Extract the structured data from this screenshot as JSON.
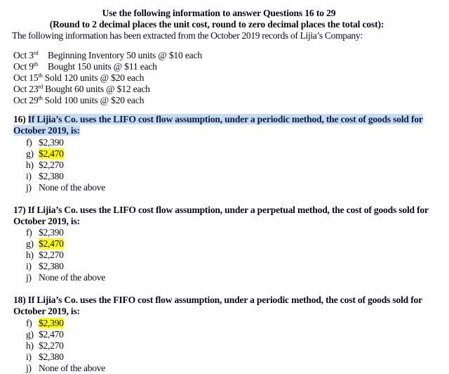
{
  "header": {
    "line1": "Use the following information to answer Questions 16 to 29",
    "line2": "(Round to 2 decimal places the unit cost, round to zero decimal places the total cost):"
  },
  "intro": "The following information has been extracted from the October 2019 records of Lijia’s Company:",
  "records": [
    {
      "date_prefix": "Oct 3",
      "suffix": "rd",
      "text": "Beginning Inventory 50 units @ $10 each"
    },
    {
      "date_prefix": "Oct 9",
      "suffix": "th",
      "text": "Bought 150 units @ $11 each"
    },
    {
      "date_prefix": "Oct 15",
      "suffix": "th",
      "text": "Sold 120 units @ $20 each"
    },
    {
      "date_prefix": "Oct 23",
      "suffix": "rd",
      "text": "Bought 60 units @ $12 each"
    },
    {
      "date_prefix": "Oct 29",
      "suffix": "th",
      "text": "Sold 100 units @ $20 each"
    }
  ],
  "questions": [
    {
      "number": "16)",
      "text": "If Lijia’s Co. uses the LIFO cost flow assumption, under a periodic method, the cost of goods sold for October 2019, is:",
      "selected": true,
      "options": [
        {
          "letter": "f)",
          "value": "$2,390",
          "highlighted": false
        },
        {
          "letter": "g)",
          "value": "$2,470",
          "highlighted": true
        },
        {
          "letter": "h)",
          "value": "$2,270",
          "highlighted": false
        },
        {
          "letter": "i)",
          "value": "$2,380",
          "highlighted": false
        },
        {
          "letter": "j)",
          "value": "None of the above",
          "highlighted": false
        }
      ]
    },
    {
      "number": "17)",
      "text": "If Lijia’s Co. uses the LIFO cost flow assumption, under a perpetual method, the cost of goods sold for October 2019, is:",
      "selected": false,
      "options": [
        {
          "letter": "f)",
          "value": "$2,390",
          "highlighted": false
        },
        {
          "letter": "g)",
          "value": "$2,470",
          "highlighted": true
        },
        {
          "letter": "h)",
          "value": "$2,270",
          "highlighted": false
        },
        {
          "letter": "i)",
          "value": "$2,380",
          "highlighted": false
        },
        {
          "letter": "j)",
          "value": "None of the above",
          "highlighted": false
        }
      ]
    },
    {
      "number": "18)",
      "text": "If Lijia’s Co. uses the FIFO cost flow assumption, under a periodic method, the cost of goods sold for October 2019, is:",
      "selected": false,
      "options": [
        {
          "letter": "f)",
          "value": "$2,390",
          "highlighted": true
        },
        {
          "letter": "g)",
          "value": "$2,470",
          "highlighted": false
        },
        {
          "letter": "h)",
          "value": "$2,270",
          "highlighted": false
        },
        {
          "letter": "i)",
          "value": "$2,380",
          "highlighted": false
        },
        {
          "letter": "j)",
          "value": "None of the above",
          "highlighted": false
        }
      ]
    }
  ],
  "colors": {
    "text": "#0b0b14",
    "selection": "#c5dcf5",
    "answer_highlight": "#ffff00"
  }
}
